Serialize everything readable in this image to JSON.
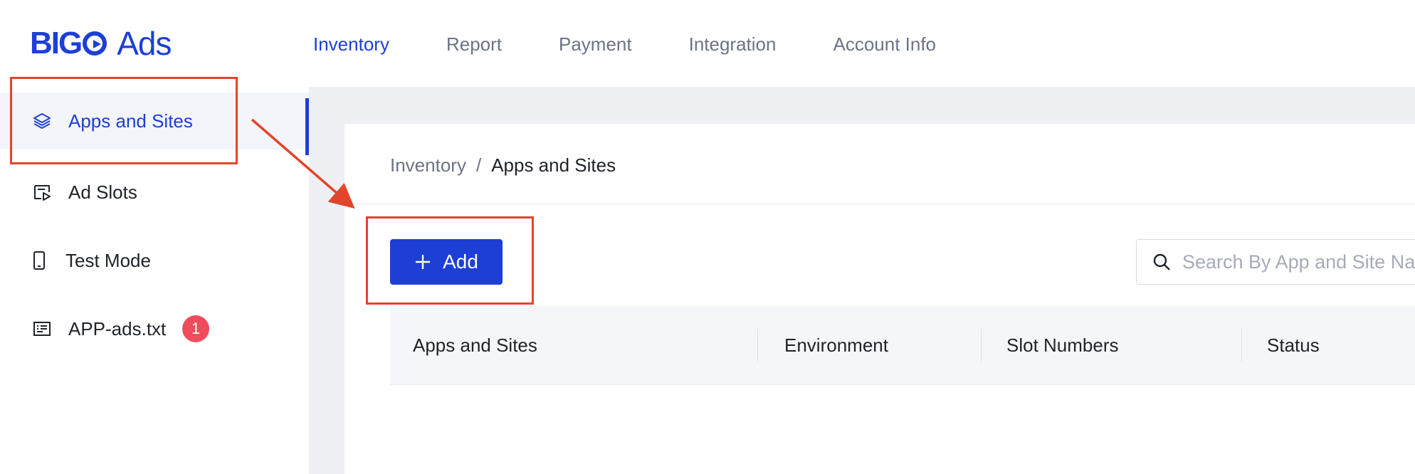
{
  "brand": {
    "logo_bold": "BIG",
    "logo_light": "Ads"
  },
  "nav": [
    {
      "label": "Inventory",
      "active": true
    },
    {
      "label": "Report"
    },
    {
      "label": "Payment"
    },
    {
      "label": "Integration"
    },
    {
      "label": "Account Info"
    }
  ],
  "sidebar": {
    "items": [
      {
        "label": "Apps and Sites",
        "icon": "layers-icon",
        "active": true
      },
      {
        "label": "Ad Slots",
        "icon": "ad-slot-icon"
      },
      {
        "label": "Test Mode",
        "icon": "mobile-icon"
      },
      {
        "label": "APP-ads.txt",
        "icon": "text-file-icon",
        "badge": "1"
      }
    ]
  },
  "breadcrumb": {
    "parent": "Inventory",
    "separator": "/",
    "current": "Apps and Sites"
  },
  "toolbar": {
    "add_label": "Add",
    "search_placeholder": "Search By App and Site Name"
  },
  "table": {
    "columns": [
      "Apps and Sites",
      "Environment",
      "Slot Numbers",
      "Status"
    ]
  },
  "colors": {
    "accent": "#1d3fd6",
    "badge": "#ef4c5c",
    "annotation": "#e2452b"
  }
}
